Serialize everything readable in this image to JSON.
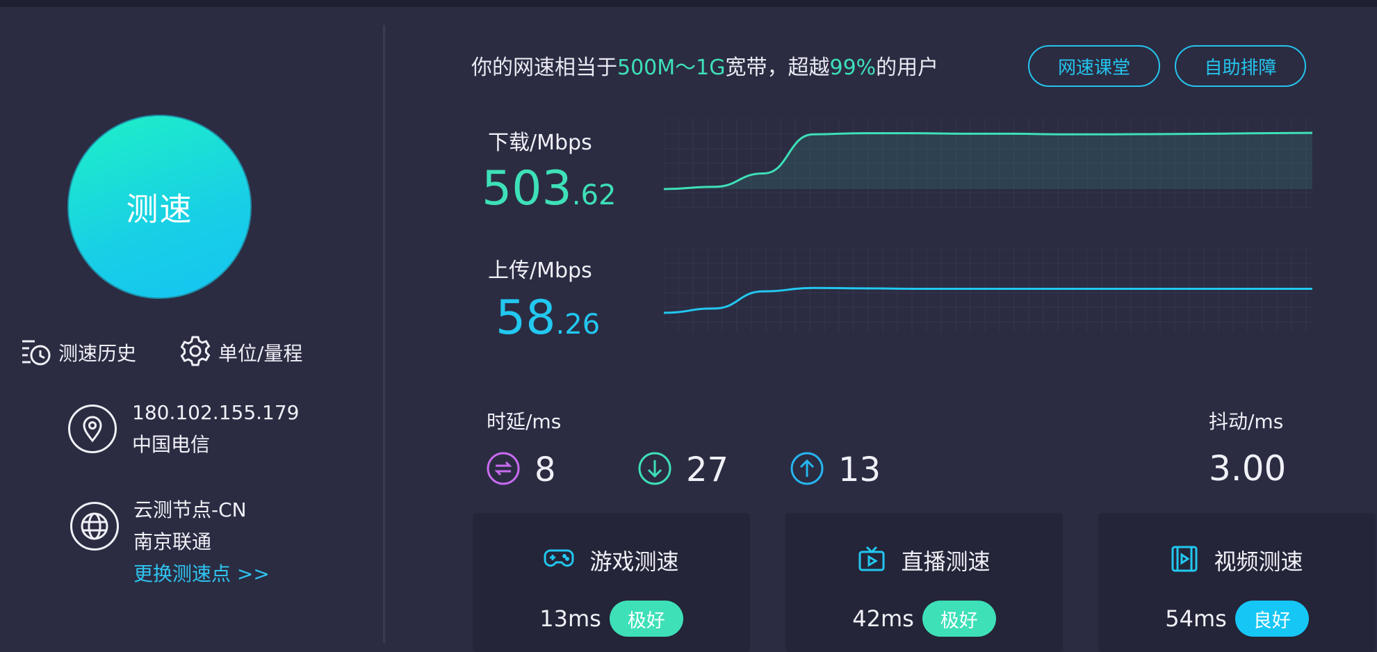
{
  "left": {
    "start_button": "测速",
    "history_label": "测速历史",
    "unit_label": "单位/量程",
    "ip": "180.102.155.179",
    "isp": "中国电信",
    "node_name": "云测节点-CN",
    "node_isp": "南京联通",
    "change_node": "更换测速点 >>"
  },
  "summary": {
    "prefix": "你的网速相当于",
    "bandwidth": "500M～1G",
    "middle": "宽带，超越",
    "percent": "99%",
    "suffix": "的用户"
  },
  "buttons": {
    "speed_class": "网速课堂",
    "self_help": "自助排障"
  },
  "download": {
    "label": "下载/Mbps",
    "integer": "503",
    "decimal": ".62",
    "color": "#3ee0b8"
  },
  "upload": {
    "label": "上传/Mbps",
    "integer": "58",
    "decimal": ".26",
    "color": "#22c8f0"
  },
  "latency": {
    "label": "时延/ms",
    "idle": "8",
    "down": "27",
    "up": "13",
    "colors": {
      "idle": "#c86bf0",
      "down": "#3ee0b8",
      "up": "#25b6f0"
    }
  },
  "jitter": {
    "label": "抖动/ms",
    "value": "3.00"
  },
  "cards": [
    {
      "icon": "gamepad-icon",
      "title": "游戏测速",
      "ms": "13ms",
      "badge": "极好",
      "badge_color": "#3ee0b8"
    },
    {
      "icon": "tv-icon",
      "title": "直播测速",
      "ms": "42ms",
      "badge": "极好",
      "badge_color": "#3ee0b8"
    },
    {
      "icon": "film-icon",
      "title": "视频测速",
      "ms": "54ms",
      "badge": "良好",
      "badge_color": "#16c6f5"
    }
  ],
  "chart_data": [
    {
      "type": "area",
      "series": [
        {
          "values": [
            0,
            20,
            140,
            490,
            500,
            500,
            495,
            495,
            490,
            490,
            492,
            495,
            500,
            503
          ]
        }
      ]
    },
    {
      "type": "line",
      "series": [
        {
          "values": [
            0,
            10,
            50,
            58,
            57,
            56,
            56,
            56,
            56,
            56,
            56,
            56,
            56,
            56
          ]
        }
      ]
    }
  ]
}
